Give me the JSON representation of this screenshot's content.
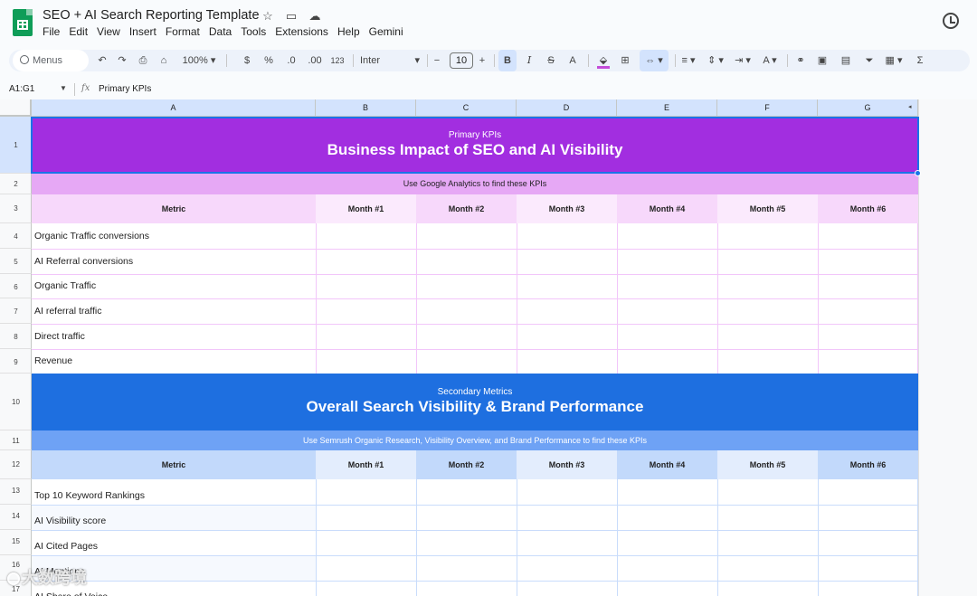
{
  "app": {
    "doc_title": "SEO + AI Search Reporting Template",
    "menu": [
      "File",
      "Edit",
      "View",
      "Insert",
      "Format",
      "Data",
      "Tools",
      "Extensions",
      "Help",
      "Gemini"
    ]
  },
  "toolbar": {
    "menus_label": "Menus",
    "zoom": "100%",
    "currency": "$",
    "percent": "%",
    "dec_decrease": ".0",
    "dec_increase": ".00",
    "number_format": "123",
    "font": "Inter",
    "font_size": "10",
    "bold": "B",
    "italic": "I",
    "strike": "S",
    "text_color": "A",
    "minus": "−",
    "plus": "+",
    "sum": "Σ"
  },
  "formula_bar": {
    "name_box": "A1:G1",
    "fx": "fx",
    "content": "Primary KPIs"
  },
  "columns": [
    "A",
    "B",
    "C",
    "D",
    "E",
    "F",
    "G"
  ],
  "rows": [
    "1",
    "2",
    "3",
    "4",
    "5",
    "6",
    "7",
    "8",
    "9",
    "10",
    "11",
    "12",
    "13",
    "14",
    "15",
    "16",
    "17"
  ],
  "primary": {
    "label": "Primary KPIs",
    "title": "Business Impact of SEO and AI Visibility",
    "note": "Use Google Analytics to find these KPIs",
    "header_metric": "Metric",
    "months": [
      "Month #1",
      "Month #2",
      "Month #3",
      "Month #4",
      "Month #5",
      "Month #6"
    ],
    "metrics": [
      "Organic Traffic conversions",
      "AI Referral conversions",
      "Organic Traffic",
      "AI referral traffic",
      "Direct traffic",
      "Revenue"
    ]
  },
  "secondary": {
    "label": "Secondary Metrics",
    "title": "Overall Search Visibility & Brand Performance",
    "note": "Use Semrush Organic Research, Visibility Overview, and Brand Performance to find these KPIs",
    "header_metric": "Metric",
    "months": [
      "Month #1",
      "Month #2",
      "Month #3",
      "Month #4",
      "Month #5",
      "Month #6"
    ],
    "metrics": [
      "Top 10 Keyword Rankings",
      "AI Visibility score",
      "AI Cited Pages",
      "AI Mentions",
      "AI Share of Voice"
    ]
  },
  "watermark": "大数跨境",
  "colors": {
    "primary_band": "#a22ee0",
    "primary_strip": "#e6a8f5",
    "secondary_band": "#1e6fe0",
    "secondary_strip": "#6ea2f5"
  }
}
